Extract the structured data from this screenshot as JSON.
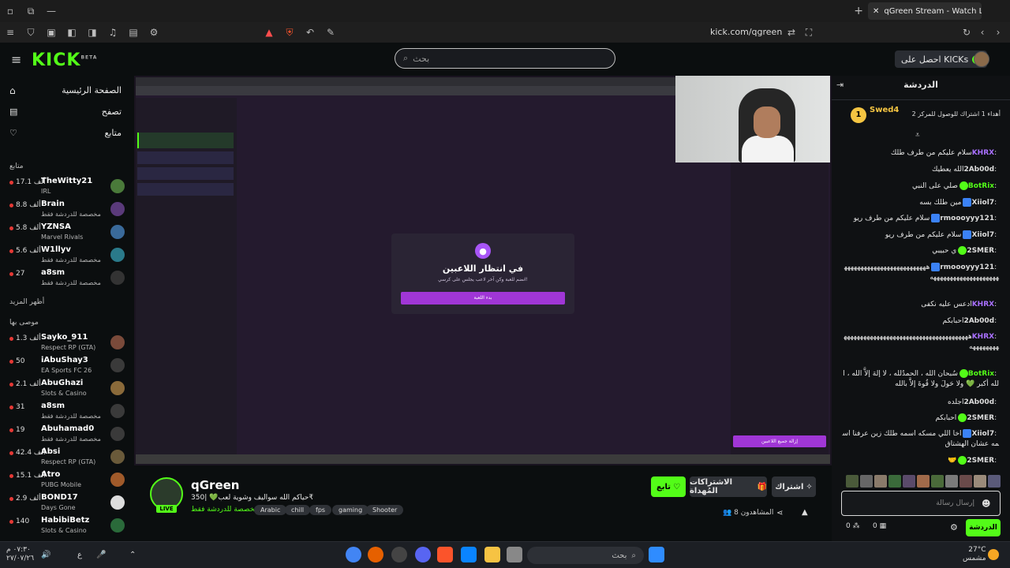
{
  "browser": {
    "tab_title": "qGreen Stream - Watch Live o",
    "url": "kick.com/qgreen"
  },
  "header": {
    "logo": "KICK",
    "logo_beta": "BETA",
    "search_placeholder": "بحث",
    "get_kicks": "احصل على KICKs"
  },
  "sidebar": {
    "nav": [
      {
        "label": "الصفحة الرئيسية",
        "icon": "home-icon"
      },
      {
        "label": "تصفح",
        "icon": "browse-icon"
      },
      {
        "label": "متابع",
        "icon": "heart-icon"
      }
    ],
    "following_heading": "متابع",
    "following": [
      {
        "name": "TheWitty21",
        "viewers": "17.1 ألف",
        "category": "IRL"
      },
      {
        "name": "Brain",
        "viewers": "8.8 ألف",
        "category": "مخصصة للدردشة فقط"
      },
      {
        "name": "YZNSA",
        "viewers": "5.8 ألف",
        "category": "Marvel Rivals"
      },
      {
        "name": "W1llyv",
        "viewers": "5.6 ألف",
        "category": "مخصصة للدردشة فقط"
      },
      {
        "name": "a8sm",
        "viewers": "27",
        "category": "مخصصة للدردشة فقط"
      }
    ],
    "show_more": "أظهر المزيد",
    "recommended_heading": "موصى بها",
    "recommended": [
      {
        "name": "Sayko_911",
        "viewers": "1.3 ألف",
        "category": "Respect RP (GTA)"
      },
      {
        "name": "iAbuShay3",
        "viewers": "50",
        "category": "EA Sports FC 26"
      },
      {
        "name": "AbuGhazi",
        "viewers": "2.1 ألف",
        "category": "Slots & Casino"
      },
      {
        "name": "a8sm",
        "viewers": "31",
        "category": "مخصصة للدردشة فقط"
      },
      {
        "name": "Abuhamad0",
        "viewers": "19",
        "category": "مخصصة للدردشة فقط"
      },
      {
        "name": "Absi",
        "viewers": "42.4 ألف",
        "category": "Respect RP (GTA)"
      },
      {
        "name": "Atro",
        "viewers": "15.1 ألف",
        "category": "PUBG Mobile"
      },
      {
        "name": "BOND17",
        "viewers": "2.9 ألف",
        "category": "Days Gone"
      },
      {
        "name": "HabibiBetz",
        "viewers": "140",
        "category": "Slots & Casino"
      }
    ]
  },
  "video": {
    "modal_title": "في انتظار اللاعبين",
    "modal_subtitle": "انضم للعبة وكن آخر لاعب يجلس على كرسي!",
    "modal_button": "بدء اللعبة",
    "side_button": "إزالة جميع اللاعبين"
  },
  "stream": {
    "name": "qGreen",
    "title": "حياكم الله سواليف وشوية لعب💚 |350₹",
    "category": "مخصصة للدردشة فقط",
    "tags": [
      "Arabic",
      "chill",
      "fps",
      "gaming",
      "Shooter"
    ],
    "follow": "تابع",
    "gift_subs": "الاشتراكات المُهداة",
    "subscribe": "اشتراك",
    "viewers": "8 المشاهدون"
  },
  "chat": {
    "title": "الدردشة",
    "pinned_user": "Swed4",
    "pinned_rank": "1",
    "pinned_text": "أهداء 1 اشتراك للوصول للمركز 2",
    "messages": [
      {
        "user": "KHRX",
        "color": "#a970ff",
        "text": "سلام عليكم من طرف طلك"
      },
      {
        "user": "2Ab00d",
        "color": "#dddddd",
        "text": "الله يعطيك"
      },
      {
        "user": "BotRix",
        "color": "#53fc18",
        "text": "صلي على النبي"
      },
      {
        "user": "Xiiol7",
        "color": "#dddddd",
        "text": "مين طلك بسه"
      },
      {
        "user": "rmoooyyy121",
        "color": "#dddddd",
        "text": "سلام عليكم من طرف ريو"
      },
      {
        "user": "Xiiol7",
        "color": "#dddddd",
        "text": "سلام عليكم من طرف ريو"
      },
      {
        "user": "2SMER",
        "color": "#dddddd",
        "text": "ي حبيبي"
      },
      {
        "user": "rmoooyyy121",
        "color": "#dddddd",
        "text": "ههههههههههههههههههههههههههههههههههههههههههههههه"
      },
      {
        "user": "KHRX",
        "color": "#a970ff",
        "text": "ادعس عليه نكفى"
      },
      {
        "user": "2Ab00d",
        "color": "#dddddd",
        "text": "احبابكم"
      },
      {
        "user": "KHRX",
        "color": "#a970ff",
        "text": "هههههههههههههههههههههههههههههههههههههههههههههههه"
      },
      {
        "user": "BotRix",
        "color": "#53fc18",
        "text": "سُبحان الله ، الحمدُلله ، لا إلهَ إلاَّ الله ، الله أكبر 💚 ولا حَولَ ولا قُوةَ إلاَّ بالله"
      },
      {
        "user": "2Ab00d",
        "color": "#dddddd",
        "text": "اجلده"
      },
      {
        "user": "2SMER",
        "color": "#dddddd",
        "text": "احبابكم"
      },
      {
        "user": "Xiiol7",
        "color": "#dddddd",
        "text": "اخا اللي مسكه اسمه طلك زين عرفنا اسمه عشان الهشتاق"
      },
      {
        "user": "2SMER",
        "color": "#dddddd",
        "text": "🤝"
      }
    ],
    "input_placeholder": "إرسال رسالة",
    "send": "الدردشة",
    "count_a": "0",
    "count_b": "0"
  },
  "taskbar": {
    "time": "٠٧:٣٠ م",
    "date": "٢٧/٠٧/٢٦",
    "search": "بحث",
    "temp": "27°C",
    "weather": "مشمس"
  }
}
